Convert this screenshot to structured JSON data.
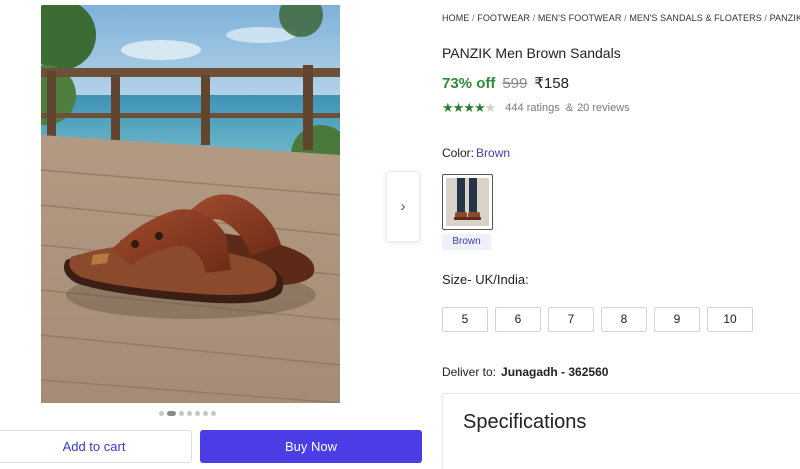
{
  "breadcrumbs": [
    "HOME",
    "FOOTWEAR",
    "MEN'S FOOTWEAR",
    "MEN'S SANDALS & FLOATERS",
    "PANZIK MEN'S SE"
  ],
  "breadcrumb_separator": "/",
  "product": {
    "title": "PANZIK Men Brown Sandals",
    "discount": "73% off",
    "mrp": "599",
    "price": "₹158",
    "rating_stars": 4,
    "rating_max": 5,
    "ratings_count": "444 ratings",
    "reviews_separator": "&",
    "reviews_count": "20 reviews"
  },
  "color": {
    "label": "Color:",
    "value": "Brown",
    "swatch_label": "Brown"
  },
  "size": {
    "heading": "Size- UK/India:",
    "options": [
      "5",
      "6",
      "7",
      "8",
      "9",
      "10"
    ]
  },
  "delivery": {
    "label": "Deliver to:",
    "value": "Junagadh - 362560"
  },
  "specifications": {
    "title": "Specifications"
  },
  "carousel": {
    "total_slides": 7,
    "active_slide": 2,
    "next_icon": "chevron-right-icon",
    "next_glyph": "›"
  },
  "actions": {
    "add_to_cart": "Add to cart",
    "buy_now": "Buy Now"
  },
  "colors": {
    "discount_green": "#2e8b3a",
    "star_green": "#2e7d32",
    "accent_blue": "#4b3de6",
    "link_blue": "#3f3fa6"
  }
}
